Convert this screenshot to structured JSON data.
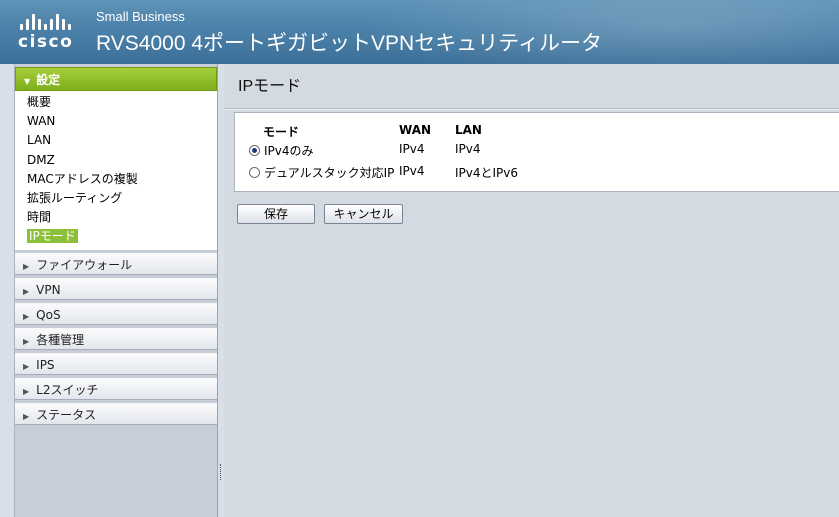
{
  "header": {
    "logo_word": "cisco",
    "brand_sub": "Small Business",
    "title": "RVS4000 4ポートギガビットVPNセキュリティルータ"
  },
  "sidebar": {
    "active_section": "設定",
    "sub_items": [
      {
        "label": "概要"
      },
      {
        "label": "WAN"
      },
      {
        "label": "LAN"
      },
      {
        "label": "DMZ"
      },
      {
        "label": "MACアドレスの複製"
      },
      {
        "label": "拡張ルーティング"
      },
      {
        "label": "時間"
      },
      {
        "label": "IPモード",
        "active": true
      }
    ],
    "sections": [
      {
        "label": "ファイアウォール"
      },
      {
        "label": "VPN"
      },
      {
        "label": "QoS"
      },
      {
        "label": "各種管理"
      },
      {
        "label": "IPS"
      },
      {
        "label": "L2スイッチ"
      },
      {
        "label": "ステータス"
      }
    ]
  },
  "main": {
    "page_title": "IPモード",
    "table": {
      "headers": {
        "mode": "モード",
        "wan": "WAN",
        "lan": "LAN"
      },
      "rows": [
        {
          "mode": "IPv4のみ",
          "wan": "IPv4",
          "lan": "IPv4",
          "selected": true
        },
        {
          "mode": "デュアルスタック対応IP",
          "wan": "IPv4",
          "lan": "IPv4とIPv6",
          "selected": false
        }
      ]
    },
    "buttons": {
      "save": "保存",
      "cancel": "キャンセル"
    }
  },
  "colors": {
    "header_blue": "#4b81a9",
    "accent_green": "#8cc03a"
  }
}
